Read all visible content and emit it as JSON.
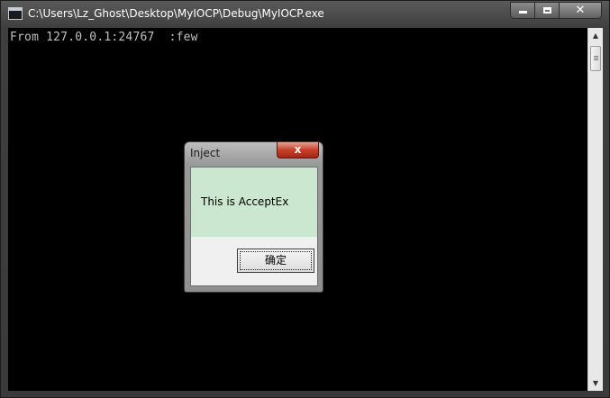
{
  "window": {
    "title": "C:\\Users\\Lz_Ghost\\Desktop\\MyIOCP\\Debug\\MyIOCP.exe",
    "icon": "console-app-icon",
    "controls": {
      "minimize": "minimize-icon",
      "maximize": "maximize-icon",
      "close": "✕"
    }
  },
  "console": {
    "lines": [
      "From 127.0.0.1:24767  :few"
    ]
  },
  "scrollbar": {
    "up": "▲",
    "down": "▼"
  },
  "dialog": {
    "title": "Inject",
    "close": "x",
    "message": "This is AcceptEx",
    "ok_label": "确定"
  }
}
